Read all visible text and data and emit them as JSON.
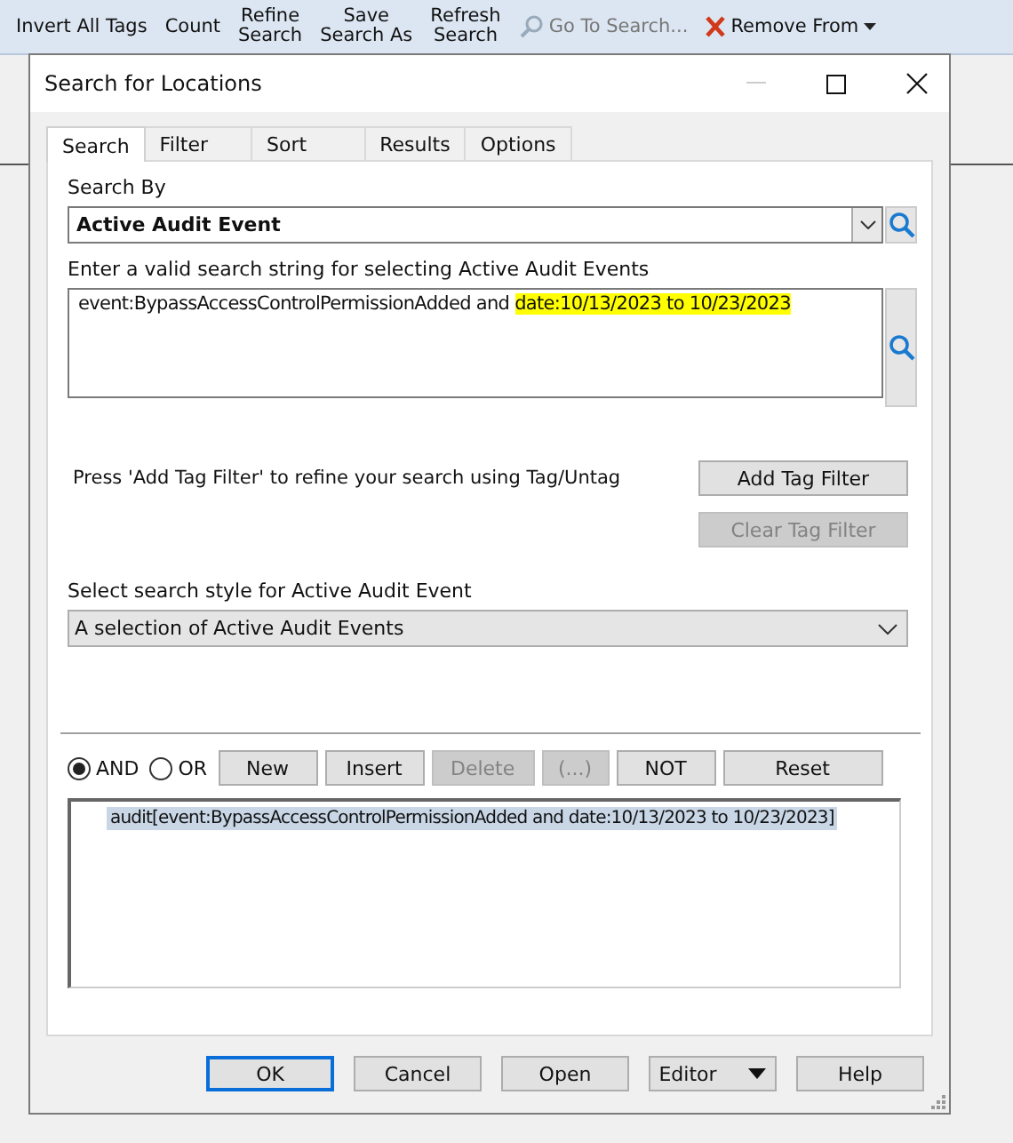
{
  "app_toolbar": {
    "items": [
      {
        "label": "Invert All Tags",
        "kind": "text",
        "disabled": false,
        "dropdown": false
      },
      {
        "label": "Count",
        "kind": "text",
        "disabled": false,
        "dropdown": false
      },
      {
        "label": "Refine\nSearch",
        "kind": "text",
        "disabled": false,
        "dropdown": false
      },
      {
        "label": "Save\nSearch As",
        "kind": "text",
        "disabled": false,
        "dropdown": false
      },
      {
        "label": "Refresh\nSearch",
        "kind": "text",
        "disabled": false,
        "dropdown": false
      },
      {
        "label": "Go To Search...",
        "kind": "search",
        "disabled": true,
        "dropdown": false
      },
      {
        "label": "Remove From",
        "kind": "remove",
        "disabled": false,
        "dropdown": true
      }
    ]
  },
  "dialog": {
    "title": "Search for Locations",
    "tabs": [
      {
        "label": "Search",
        "selected": true
      },
      {
        "label": "Filter",
        "selected": false
      },
      {
        "label": "Sort",
        "selected": false
      },
      {
        "label": "Results",
        "selected": false
      },
      {
        "label": "Options",
        "selected": false
      }
    ],
    "search_by": {
      "label": "Search By",
      "value": "Active Audit Event"
    },
    "query": {
      "label": "Enter a valid search string for selecting Active Audit Events",
      "segments": [
        {
          "text": "event:BypassAccessControlPermissionAdded and ",
          "highlighted": false
        },
        {
          "text": "date:10/13/2023 to 10/23/2023",
          "highlighted": true
        }
      ]
    },
    "tag_hint": "Press 'Add Tag Filter' to refine your search using Tag/Untag",
    "tag_buttons": [
      {
        "label": "Add Tag Filter",
        "disabled": false
      },
      {
        "label": "Clear Tag Filter",
        "disabled": true
      }
    ],
    "style": {
      "label": "Select search style for Active Audit Event",
      "value": "A selection of Active Audit Events"
    },
    "logic_radios": [
      {
        "label": "AND",
        "selected": true
      },
      {
        "label": "OR",
        "selected": false
      }
    ],
    "logic_buttons": [
      {
        "label": "New",
        "disabled": false
      },
      {
        "label": "Insert",
        "disabled": false
      },
      {
        "label": "Delete",
        "disabled": true
      },
      {
        "label": "(...)",
        "disabled": true
      },
      {
        "label": "NOT",
        "disabled": false
      },
      {
        "label": "Reset",
        "disabled": false
      }
    ],
    "expressions": [
      {
        "text": "audit[event:BypassAccessControlPermissionAdded and date:10/13/2023 to 10/23/2023]",
        "selected": true
      }
    ],
    "footer_buttons": [
      {
        "label": "OK",
        "default": true,
        "dropdown": false
      },
      {
        "label": "Cancel",
        "default": false,
        "dropdown": false
      },
      {
        "label": "Open",
        "default": false,
        "dropdown": false
      },
      {
        "label": "Editor",
        "default": false,
        "dropdown": true
      },
      {
        "label": "Help",
        "default": false,
        "dropdown": false
      }
    ]
  }
}
